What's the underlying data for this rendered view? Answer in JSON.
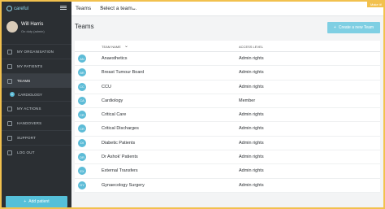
{
  "app": {
    "brand": "careful",
    "badge": "Make it!"
  },
  "user": {
    "name": "Will Harris",
    "status": "On duty (admin)"
  },
  "sidebar": {
    "items": [
      {
        "label": "MY ORGANISATION",
        "icon": "building-icon"
      },
      {
        "label": "MY PATIENTS",
        "icon": "patients-icon"
      },
      {
        "label": "TEAMS",
        "icon": "teams-icon",
        "active": true
      },
      {
        "label": "MY ACTIONS",
        "icon": "actions-icon"
      },
      {
        "label": "HANDOVERS",
        "icon": "handover-icon"
      },
      {
        "label": "SUPPORT",
        "icon": "support-icon"
      },
      {
        "label": "LOG OUT",
        "icon": "logout-icon"
      }
    ],
    "sub_item": {
      "initials": "C",
      "label": "CARDIOLOGY"
    },
    "add_patient": "Add patient"
  },
  "topbar": {
    "crumb": "Teams",
    "team_select": "Select a team..."
  },
  "main": {
    "title": "Teams",
    "create_button": "Create a new Team",
    "columns": {
      "name": "TEAM NAME",
      "access": "ACCESS LEVEL"
    },
    "rows": [
      {
        "initials": "AN",
        "name": "Anaesthetics",
        "access": "Admin rights"
      },
      {
        "initials": "BR",
        "name": "Breast Tumour Board",
        "access": "Admin rights"
      },
      {
        "initials": "CC",
        "name": "CCU",
        "access": "Admin rights"
      },
      {
        "initials": "CA",
        "name": "Cardiology",
        "access": "Member"
      },
      {
        "initials": "CR",
        "name": "Critical Care",
        "access": "Admin rights"
      },
      {
        "initials": "CR",
        "name": "Critical Discharges",
        "access": "Admin rights"
      },
      {
        "initials": "DI",
        "name": "Diabetic Patients",
        "access": "Admin rights"
      },
      {
        "initials": "DR",
        "name": "Dr Ashok' Patients",
        "access": "Admin rights"
      },
      {
        "initials": "EX",
        "name": "External Transfers",
        "access": "Admin rights"
      },
      {
        "initials": "GY",
        "name": "Gynaecology Surgery",
        "access": "Admin rights"
      }
    ]
  }
}
